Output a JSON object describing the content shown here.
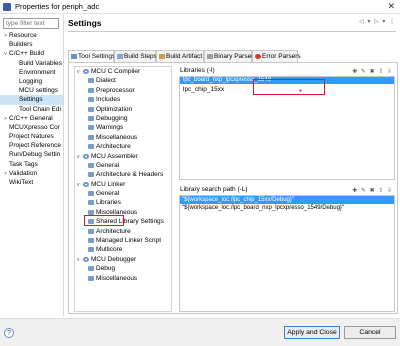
{
  "window": {
    "title": "Properties for periph_adc",
    "close": "✕"
  },
  "filter": {
    "placeholder": "type filter text"
  },
  "nav": {
    "items": [
      {
        "label": "Resource",
        "arrow": ">",
        "indent": 0
      },
      {
        "label": "Builders",
        "arrow": "",
        "indent": 0
      },
      {
        "label": "C/C++ Build",
        "arrow": "v",
        "indent": 0
      },
      {
        "label": "Build Variables",
        "arrow": "",
        "indent": 1
      },
      {
        "label": "Environment",
        "arrow": "",
        "indent": 1
      },
      {
        "label": "Logging",
        "arrow": "",
        "indent": 1
      },
      {
        "label": "MCU settings",
        "arrow": "",
        "indent": 1
      },
      {
        "label": "Settings",
        "arrow": "",
        "indent": 1,
        "selected": true
      },
      {
        "label": "Tool Chain Edi",
        "arrow": "",
        "indent": 1
      },
      {
        "label": "C/C++ General",
        "arrow": ">",
        "indent": 0
      },
      {
        "label": "MCUXpresso Cor",
        "arrow": "",
        "indent": 0
      },
      {
        "label": "Project Natures",
        "arrow": "",
        "indent": 0
      },
      {
        "label": "Project Reference",
        "arrow": "",
        "indent": 0
      },
      {
        "label": "Run/Debug Settin",
        "arrow": "",
        "indent": 0
      },
      {
        "label": "Task Tags",
        "arrow": "",
        "indent": 0
      },
      {
        "label": "Validation",
        "arrow": ">",
        "indent": 0
      },
      {
        "label": "WikiText",
        "arrow": "",
        "indent": 0
      }
    ]
  },
  "header": {
    "title": "Settings",
    "nav_arrows": "◁ ▾ ▷ ▾ ⋮"
  },
  "tabs": [
    {
      "label": "Tool Settings",
      "active": true
    },
    {
      "label": "Build Steps"
    },
    {
      "label": "Build Artifact"
    },
    {
      "label": "Binary Parsers"
    },
    {
      "label": "Error Parsers"
    }
  ],
  "tree": [
    {
      "label": "MCU C Compiler",
      "level": 0,
      "exp": "v"
    },
    {
      "label": "Dialect",
      "level": 1
    },
    {
      "label": "Preprocessor",
      "level": 1
    },
    {
      "label": "Includes",
      "level": 1
    },
    {
      "label": "Optimization",
      "level": 1
    },
    {
      "label": "Debugging",
      "level": 1
    },
    {
      "label": "Warnings",
      "level": 1
    },
    {
      "label": "Miscellaneous",
      "level": 1
    },
    {
      "label": "Architecture",
      "level": 1
    },
    {
      "label": "MCU Assembler",
      "level": 0,
      "exp": "v"
    },
    {
      "label": "General",
      "level": 1
    },
    {
      "label": "Architecture & Headers",
      "level": 1
    },
    {
      "label": "MCU Linker",
      "level": 0,
      "exp": "v"
    },
    {
      "label": "General",
      "level": 1
    },
    {
      "label": "Libraries",
      "level": 1
    },
    {
      "label": "Miscellaneous",
      "level": 1
    },
    {
      "label": "Shared Library Settings",
      "level": 1
    },
    {
      "label": "Architecture",
      "level": 1
    },
    {
      "label": "Managed Linker Script",
      "level": 1
    },
    {
      "label": "Multicore",
      "level": 1
    },
    {
      "label": "MCU Debugger",
      "level": 0,
      "exp": "v"
    },
    {
      "label": "Debug",
      "level": 1
    },
    {
      "label": "Miscellaneous",
      "level": 1
    }
  ],
  "libraries": {
    "label": "Libraries (-l)",
    "selected_row": "lpc_board_nxp_lpcxpresso_1549",
    "edit_value": "lpc_chip_15xx",
    "toolbar_icons": "✚ ✎ ✖ ⇧ ⇩"
  },
  "search_path": {
    "label": "Library search path (-L)",
    "toolbar_icons": "✚ ✎ ✖ ⇧ ⇩",
    "rows": [
      {
        "text": "\"${workspace_loc:/lpc_chip_15xx/Debug}\"",
        "selected": true
      },
      {
        "text": "\"${workspace_loc:/lpc_board_nxp_lpcxpresso_1549/Debug}\""
      }
    ]
  },
  "footer": {
    "help": "?",
    "apply_close": "Apply and Close",
    "cancel": "Cancel"
  }
}
